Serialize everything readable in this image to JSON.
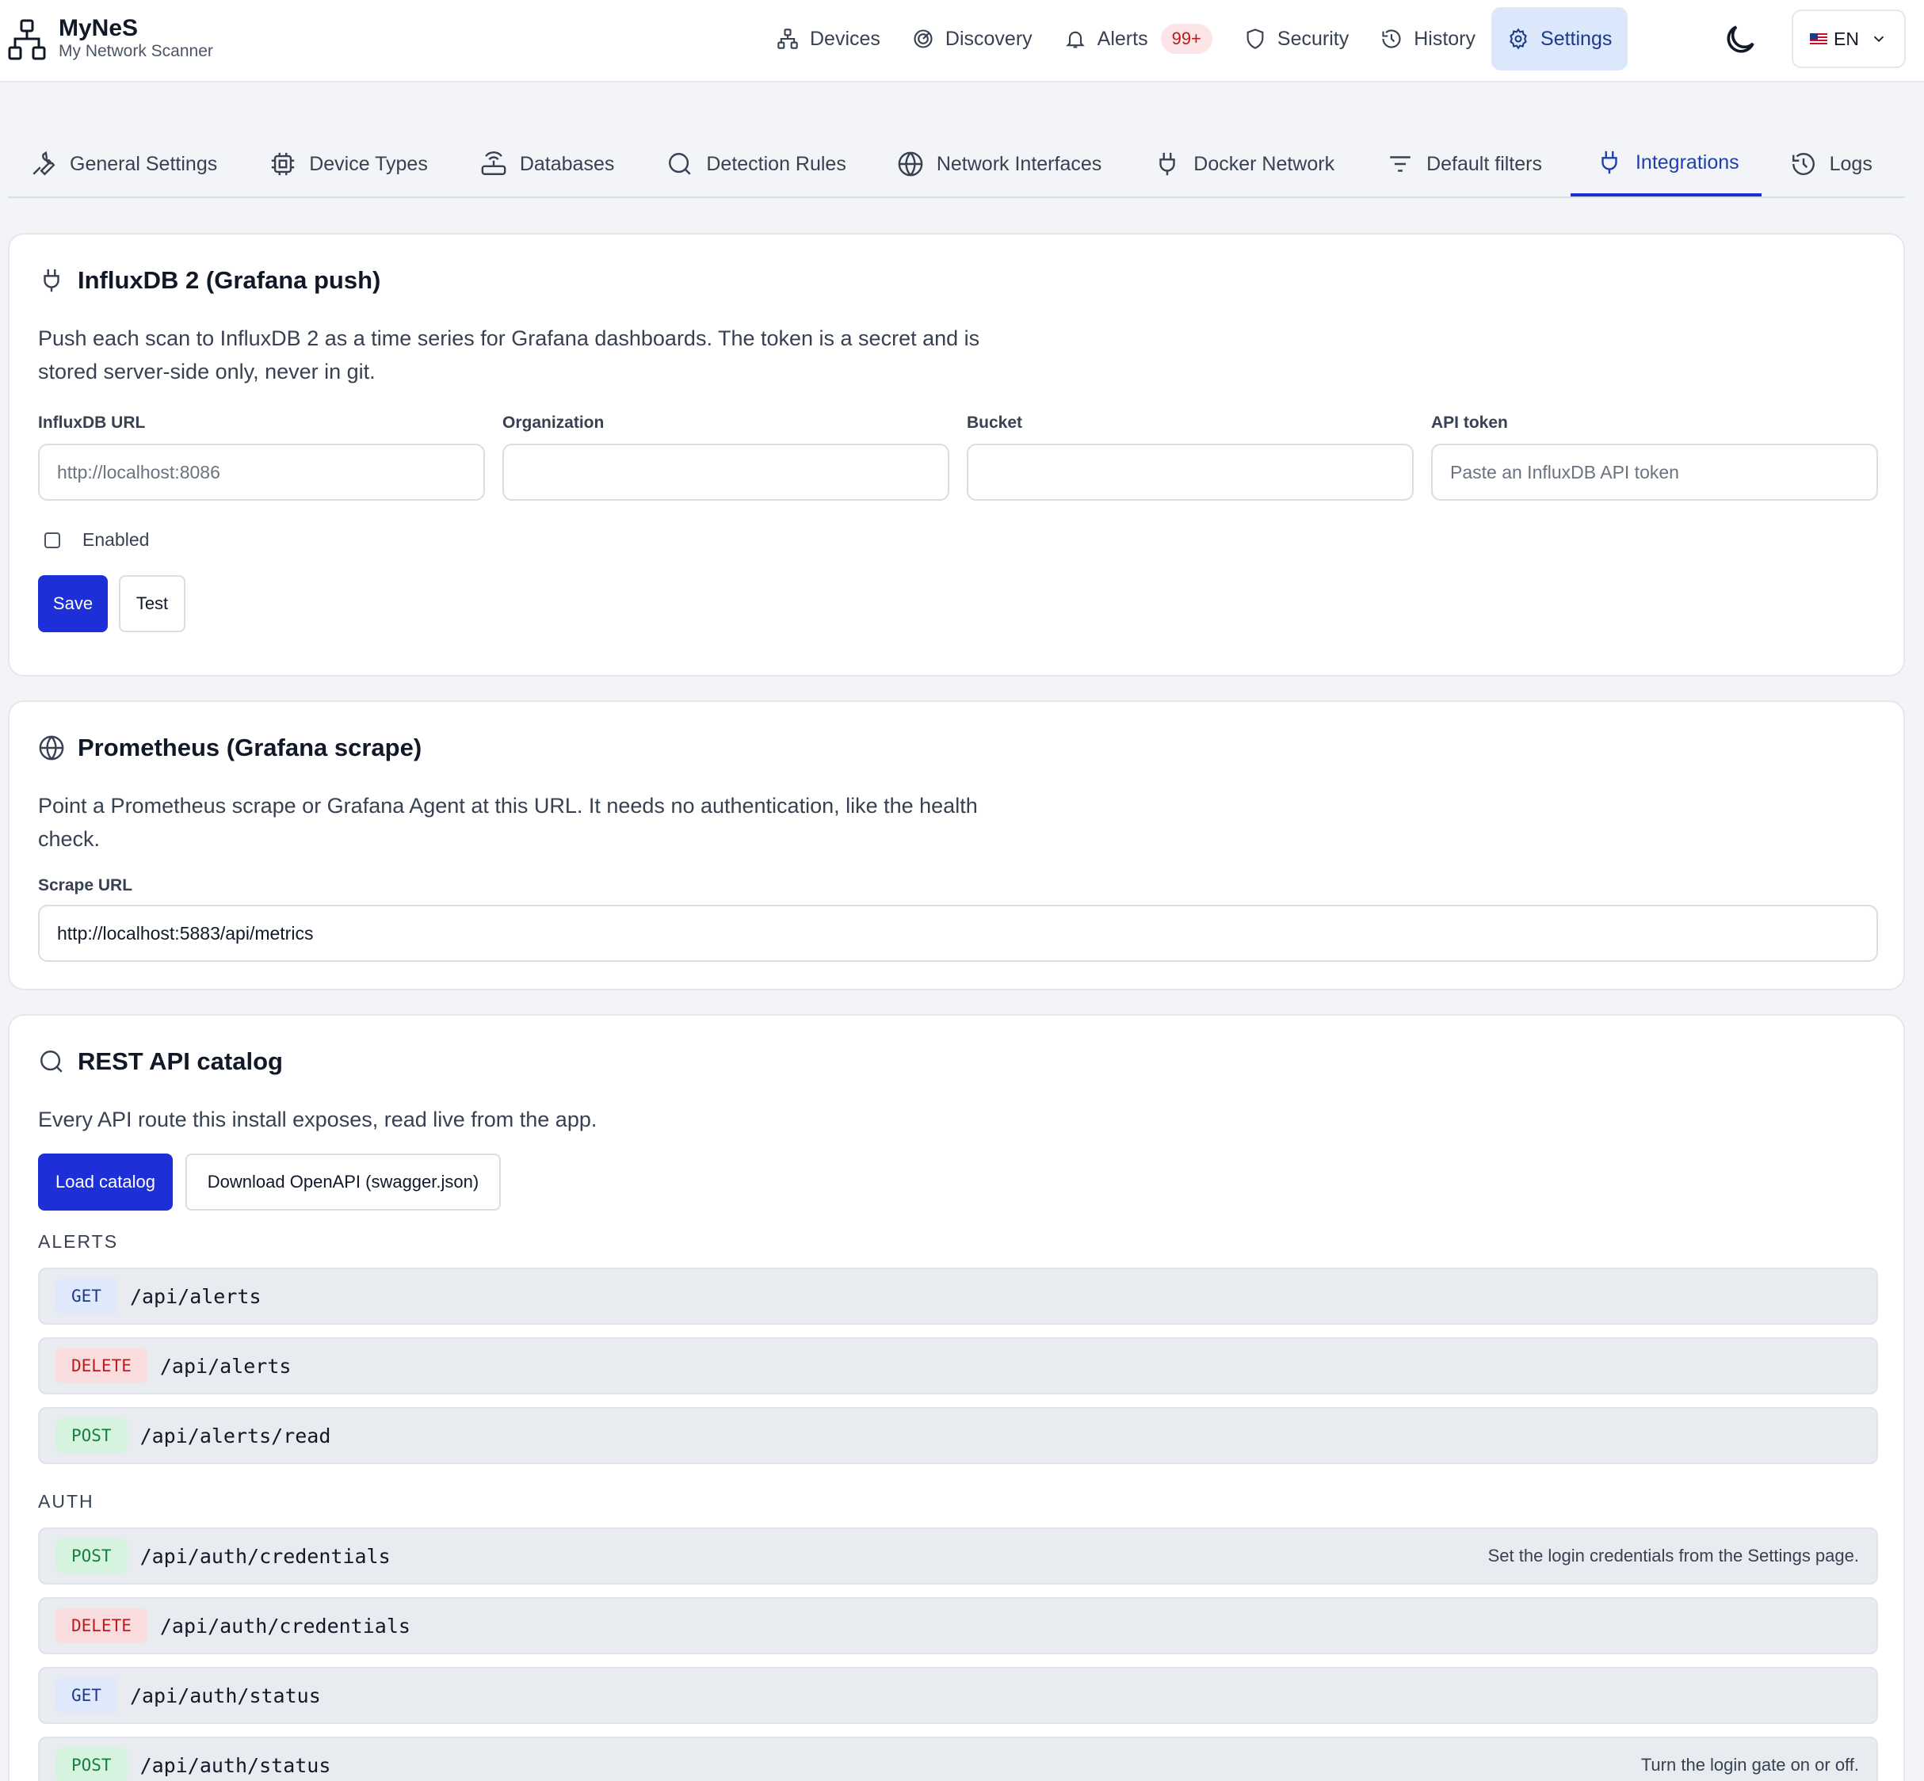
{
  "app": {
    "title": "MyNeS",
    "subtitle": "My Network Scanner"
  },
  "nav": {
    "items": [
      {
        "label": "Devices",
        "icon": "network-icon"
      },
      {
        "label": "Discovery",
        "icon": "radar-icon"
      },
      {
        "label": "Alerts",
        "icon": "bell-icon",
        "badge": "99+"
      },
      {
        "label": "Security",
        "icon": "shield-icon"
      },
      {
        "label": "History",
        "icon": "history-icon"
      },
      {
        "label": "Settings",
        "icon": "gear-icon",
        "active": true
      }
    ],
    "theme_icon": "moon-icon",
    "language": "EN"
  },
  "tabs": [
    {
      "label": "General Settings",
      "icon": "wrench-icon"
    },
    {
      "label": "Device Types",
      "icon": "chip-icon"
    },
    {
      "label": "Databases",
      "icon": "router-icon"
    },
    {
      "label": "Detection Rules",
      "icon": "search-icon"
    },
    {
      "label": "Network Interfaces",
      "icon": "globe-icon"
    },
    {
      "label": "Docker Network",
      "icon": "plug-icon"
    },
    {
      "label": "Default filters",
      "icon": "filter-icon"
    },
    {
      "label": "Integrations",
      "icon": "plug-icon",
      "active": true
    },
    {
      "label": "Logs",
      "icon": "history-icon"
    }
  ],
  "influx": {
    "title": "InfluxDB 2 (Grafana push)",
    "description": "Push each scan to InfluxDB 2 as a time series for Grafana dashboards. The token is a secret and is stored server-side only, never in git.",
    "url_label": "InfluxDB URL",
    "url_placeholder": "http://localhost:8086",
    "url_value": "",
    "org_label": "Organization",
    "org_value": "",
    "bucket_label": "Bucket",
    "bucket_value": "",
    "token_label": "API token",
    "token_placeholder": "Paste an InfluxDB API token",
    "token_value": "",
    "enabled_label": "Enabled",
    "enabled": false,
    "save_label": "Save",
    "test_label": "Test"
  },
  "prometheus": {
    "title": "Prometheus (Grafana scrape)",
    "description": "Point a Prometheus scrape or Grafana Agent at this URL. It needs no authentication, like the health check.",
    "scrape_label": "Scrape URL",
    "scrape_value": "http://localhost:5883/api/metrics"
  },
  "catalog": {
    "title": "REST API catalog",
    "description": "Every API route this install exposes, read live from the app.",
    "load_label": "Load catalog",
    "download_label": "Download OpenAPI (swagger.json)",
    "groups": [
      {
        "name": "ALERTS",
        "routes": [
          {
            "method": "GET",
            "path": "/api/alerts",
            "note": ""
          },
          {
            "method": "DELETE",
            "path": "/api/alerts",
            "note": ""
          },
          {
            "method": "POST",
            "path": "/api/alerts/read",
            "note": ""
          }
        ]
      },
      {
        "name": "AUTH",
        "routes": [
          {
            "method": "POST",
            "path": "/api/auth/credentials",
            "note": "Set the login credentials from the Settings page."
          },
          {
            "method": "DELETE",
            "path": "/api/auth/credentials",
            "note": ""
          },
          {
            "method": "GET",
            "path": "/api/auth/status",
            "note": ""
          },
          {
            "method": "POST",
            "path": "/api/auth/status",
            "note": "Turn the login gate on or off."
          }
        ]
      }
    ]
  }
}
